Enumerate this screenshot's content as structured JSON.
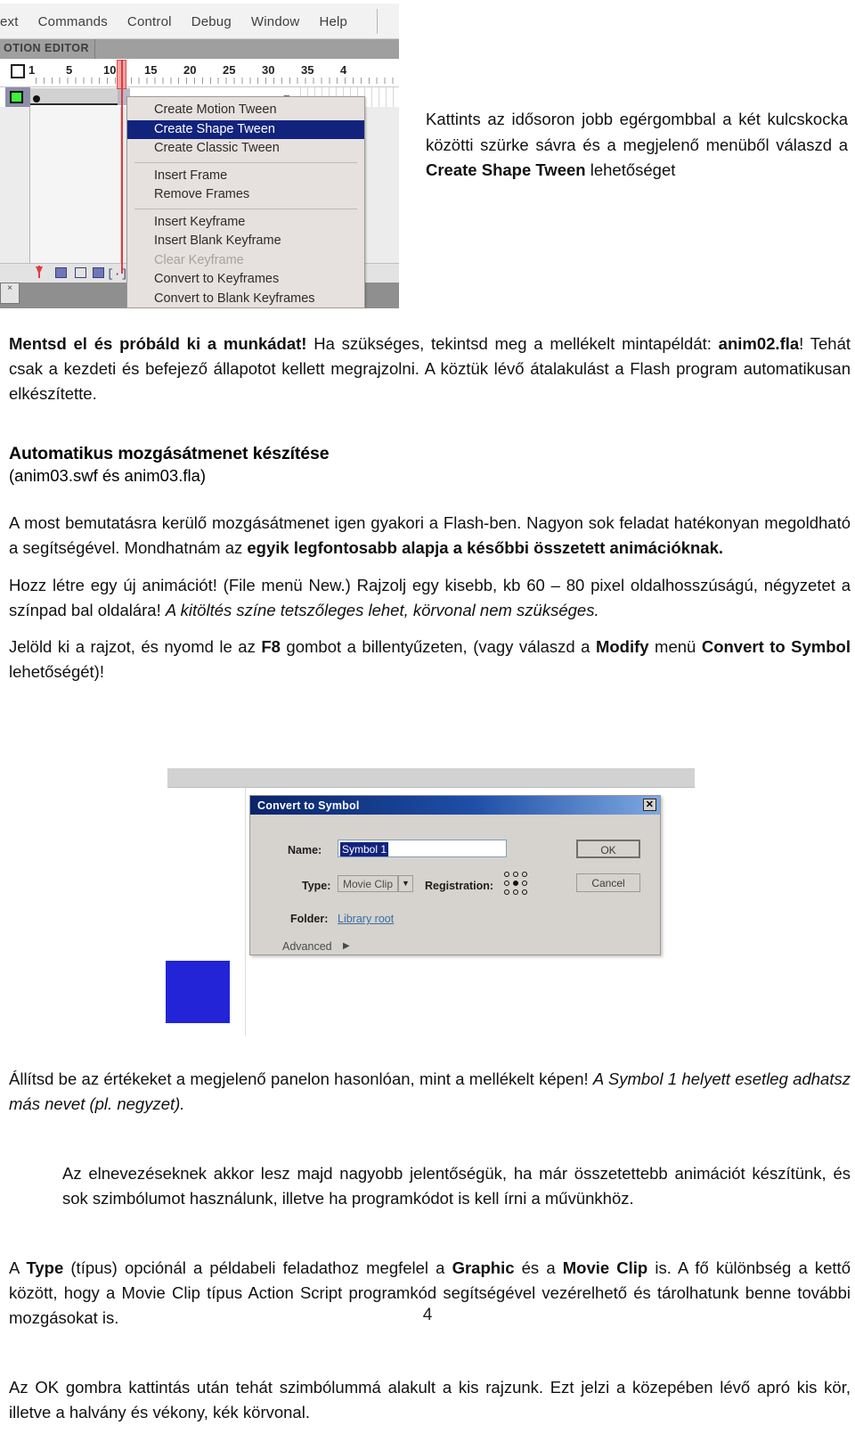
{
  "top_figure": {
    "menubar": [
      "ext",
      "Commands",
      "Control",
      "Debug",
      "Window",
      "Help"
    ],
    "panel_tab": "OTION EDITOR",
    "ruler_numbers": [
      "1",
      "5",
      "10",
      "15",
      "20",
      "25",
      "30",
      "35",
      "4"
    ],
    "context_menu": [
      {
        "label": "Create Motion Tween",
        "state": "normal"
      },
      {
        "label": "Create Shape Tween",
        "state": "selected"
      },
      {
        "label": "Create Classic Tween",
        "state": "normal"
      },
      {
        "label": "Insert Frame",
        "state": "normal"
      },
      {
        "label": "Remove Frames",
        "state": "normal"
      },
      {
        "label": "Insert Keyframe",
        "state": "normal"
      },
      {
        "label": "Insert Blank Keyframe",
        "state": "normal"
      },
      {
        "label": "Clear Keyframe",
        "state": "disabled"
      },
      {
        "label": "Convert to Keyframes",
        "state": "normal"
      },
      {
        "label": "Convert to Blank Keyframes",
        "state": "normal"
      }
    ],
    "colors": {
      "selected_menu_bg": "#12237e",
      "playhead": "#e03c3c",
      "layer_icon": "#3df13d"
    }
  },
  "top_callout": {
    "part1": "Kattints az idősoron jobb egérgombbal a két kulcskocka közötti szürke sávra és a megjelenő menüből válaszd a ",
    "bold": "Create Shape Tween",
    "part2": " lehetőséget"
  },
  "doc": {
    "p1": {
      "bold1": "Mentsd el és próbáld ki a munkádat!",
      "text1": " Ha szükséges, tekintsd meg a mellékelt mintapéldát: ",
      "bold2": "anim02.fla",
      "text2": "! Tehát csak a kezdeti és befejező állapotot kellett megrajzolni. A köztük lévő átalakulást a Flash program automatikusan elkészítette."
    },
    "heading": "Automatikus mozgásátmenet készítése",
    "subheading": "(anim03.swf és anim03.fla)",
    "p2": {
      "text1": "A most bemutatásra kerülő mozgásátmenet igen gyakori a Flash-ben. Nagyon sok feladat hatékonyan megoldható a segítségével. Mondhatnám az ",
      "bold1": "egyik legfontosabb alapja a későbbi összetett animációknak."
    },
    "p3": {
      "text1": "Hozz létre egy új animációt! (File menü New.) Rajzolj egy kisebb, kb 60 – 80 pixel oldalhosszúságú, négyzetet a színpad bal oldalára! ",
      "italic1": "A kitöltés színe tetszőleges lehet, körvonal nem szükséges."
    },
    "p4": {
      "text1": "Jelöld ki a rajzot, és nyomd le az ",
      "bold1": "F8",
      "text2": " gombot a billentyűzeten, (vagy válaszd a ",
      "bold2": "Modify",
      "text3": " menü ",
      "bold3": "Convert to Symbol",
      "text4": " lehetőségét)!"
    },
    "p5": {
      "text1": " Állítsd be az értékeket a megjelenő panelon hasonlóan, mint a mellékelt képen! ",
      "italic1": "A Symbol 1 helyett esetleg adhatsz más nevet (pl. negyzet)."
    },
    "p6": "Az elnevezéseknek akkor lesz majd nagyobb jelentőségük, ha már összetettebb animációt készítünk, és sok szimbólumot használunk, illetve ha programkódot is kell írni a művünkhöz.",
    "p7": {
      "text1": "A ",
      "bold1": "Type",
      "text2": " (típus) opciónál a példabeli feladathoz megfelel a ",
      "bold2": "Graphic",
      "text3": " és a ",
      "bold3": "Movie Clip",
      "text4": " is. A fő különbség a kettő között, hogy a Movie Clip típus Action Script programkód segítségével vezérelhető és tárolhatunk benne további mozgásokat is."
    },
    "p8": "Az OK gombra kattintás után tehát szimbólummá alakult a kis rajzunk. Ezt jelzi a közepében lévő apró kis kör, illetve a halvány és vékony, kék körvonal."
  },
  "dialog": {
    "title": "Convert to Symbol",
    "close_label": "✕",
    "name_label": "Name:",
    "name_value": "Symbol 1",
    "type_label": "Type:",
    "type_value": "Movie Clip",
    "type_arrow": "▼",
    "registration_label": "Registration:",
    "folder_label": "Folder:",
    "folder_value": "Library root",
    "advanced_label": "Advanced",
    "advanced_arrow": "▶",
    "ok_label": "OK",
    "cancel_label": "Cancel"
  },
  "page_number": "4"
}
